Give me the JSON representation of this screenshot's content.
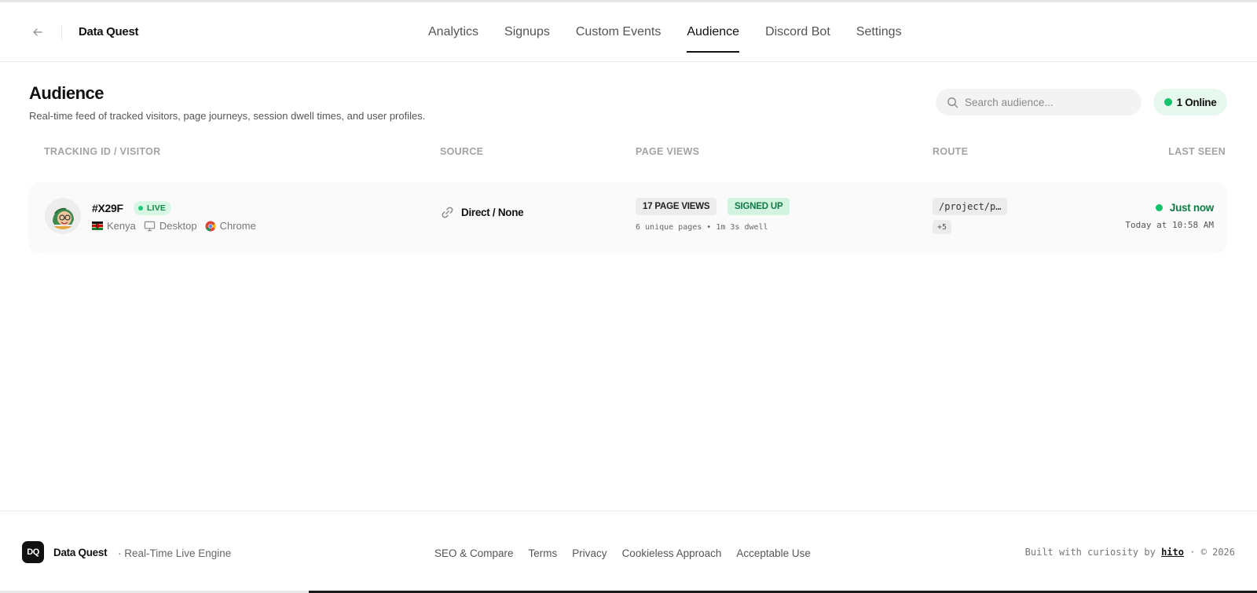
{
  "header": {
    "brand": "Data Quest",
    "nav": [
      "Analytics",
      "Signups",
      "Custom Events",
      "Audience",
      "Discord Bot",
      "Settings"
    ],
    "active_tab": "Audience"
  },
  "page": {
    "title": "Audience",
    "subtitle": "Real-time feed of tracked visitors, page journeys, session dwell times, and user profiles.",
    "search_placeholder": "Search audience...",
    "online_label": "1 Online"
  },
  "table": {
    "columns": [
      "TRACKING ID / VISITOR",
      "SOURCE",
      "PAGE VIEWS",
      "ROUTE",
      "LAST SEEN"
    ],
    "rows": [
      {
        "id": "#X29F",
        "live_label": "LIVE",
        "country": "Kenya",
        "device": "Desktop",
        "browser": "Chrome",
        "source": "Direct / None",
        "page_views_label": "17 PAGE VIEWS",
        "signed_up_label": "SIGNED UP",
        "pv_detail": "6 unique pages • 1m 3s dwell",
        "route": "/project/p…",
        "route_more": "+5",
        "last_seen_status": "Just now",
        "last_seen_time": "Today at 10:58 AM"
      }
    ]
  },
  "footer": {
    "logo_text": "DQ",
    "brand": "Data Quest",
    "tagline": "· Real-Time Live Engine",
    "links": [
      "SEO & Compare",
      "Terms",
      "Privacy",
      "Cookieless Approach",
      "Acceptable Use"
    ],
    "credit_prefix": "Built with curiosity by",
    "credit_name": "hito",
    "credit_suffix": "· © 2026"
  },
  "colors": {
    "accent_green": "#13c26b",
    "live_bg": "#d8f6e4",
    "online_bg": "#e7f8ee",
    "text_dark": "#111111"
  },
  "icons": {
    "back": "arrow-left-icon",
    "search": "search-icon",
    "device": "monitor-icon",
    "browser": "chrome-icon",
    "source": "link-icon",
    "flag": "kenya-flag-icon",
    "avatar": "avatar-illustration"
  }
}
